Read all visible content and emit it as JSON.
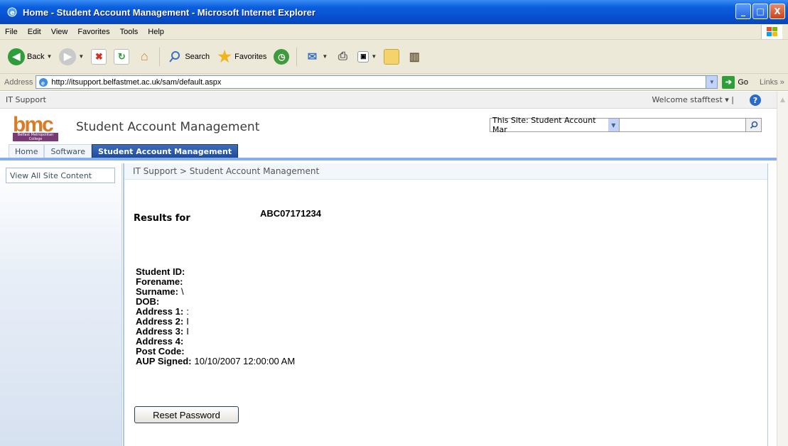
{
  "window": {
    "title": "Home - Student Account Management - Microsoft Internet Explorer",
    "minimize": "_",
    "maximize": "□",
    "close": "X"
  },
  "menu": [
    "File",
    "Edit",
    "View",
    "Favorites",
    "Tools",
    "Help"
  ],
  "toolbar": {
    "back_label": "Back",
    "search_label": "Search",
    "favorites_label": "Favorites"
  },
  "address": {
    "label": "Address",
    "url": "http://itsupport.belfastmet.ac.uk/sam/default.aspx",
    "go_label": "Go",
    "links_label": "Links"
  },
  "sharepoint": {
    "site_label": "IT Support",
    "welcome": "Welcome stafftest",
    "logo_text": "bmc",
    "logo_sub": "Belfast Metropolitan College",
    "site_title": "Student Account Management",
    "search_scope": "This Site: Student Account Mar",
    "search_value": "",
    "nav_tabs": [
      "Home",
      "Software",
      "Student Account Management"
    ],
    "active_tab": 2,
    "view_all": "View All Site Content",
    "breadcrumb": "IT Support > Student Account Management"
  },
  "results": {
    "label": "Results for",
    "value": "ABC07171234"
  },
  "student": {
    "fields": [
      {
        "key": "Student ID:",
        "value": ""
      },
      {
        "key": "Forename:",
        "value": ""
      },
      {
        "key": "Surname:",
        "value": "\\"
      },
      {
        "key": "DOB:",
        "value": ""
      },
      {
        "key": "Address 1:",
        "value": ":"
      },
      {
        "key": "Address 2:",
        "value": "I"
      },
      {
        "key": "Address 3:",
        "value": "I"
      },
      {
        "key": "Address 4:",
        "value": ""
      },
      {
        "key": "Post Code:",
        "value": ""
      },
      {
        "key": "AUP Signed:",
        "value": "10/10/2007 12:00:00 AM"
      }
    ]
  },
  "reset_button": "Reset Password"
}
